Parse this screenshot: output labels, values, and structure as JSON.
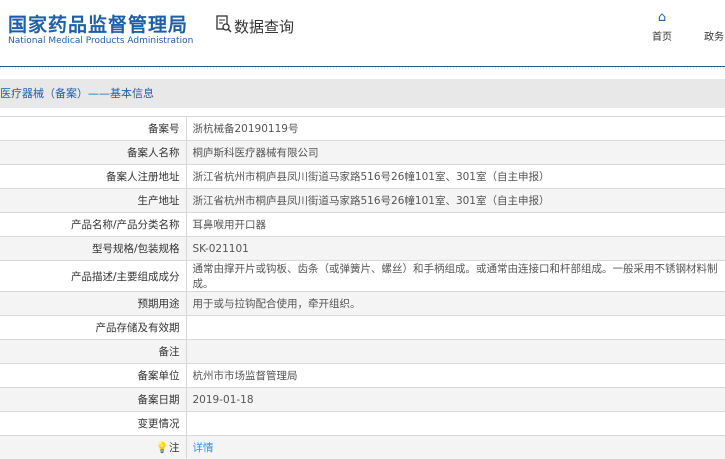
{
  "header": {
    "logo_cn": "国家药品监督管理局",
    "logo_en": "National Medical Products Administration",
    "data_query": "数据查询",
    "nav": [
      {
        "label": "首页"
      },
      {
        "label": "政务"
      }
    ]
  },
  "section_title": "医疗器械（备案）——基本信息",
  "rows": [
    {
      "label": "备案号",
      "value": "浙杭械备20190119号"
    },
    {
      "label": "备案人名称",
      "value": "桐庐斯科医疗器械有限公司"
    },
    {
      "label": "备案人注册地址",
      "value": "浙江省杭州市桐庐县凤川街道马家路516号26幢101室、301室（自主申报）"
    },
    {
      "label": "生产地址",
      "value": "浙江省杭州市桐庐县凤川街道马家路516号26幢101室、301室（自主申报）"
    },
    {
      "label": "产品名称/产品分类名称",
      "value": "耳鼻喉用开口器"
    },
    {
      "label": "型号规格/包装规格",
      "value": "SK-021101"
    },
    {
      "label": "产品描述/主要组成成分",
      "value": "通常由撑开片或钩板、齿条（或弹簧片、螺丝）和手柄组成。或通常由连接口和杆部组成。一般采用不锈钢材料制成。"
    },
    {
      "label": "预期用途",
      "value": "用于或与拉钩配合使用，牵开组织。"
    },
    {
      "label": "产品存储及有效期",
      "value": ""
    },
    {
      "label": "备注",
      "value": ""
    },
    {
      "label": "备案单位",
      "value": "杭州市市场监督管理局"
    },
    {
      "label": "备案日期",
      "value": "2019-01-18"
    },
    {
      "label": "变更情况",
      "value": ""
    }
  ],
  "note": {
    "label": "注",
    "link": "详情"
  }
}
